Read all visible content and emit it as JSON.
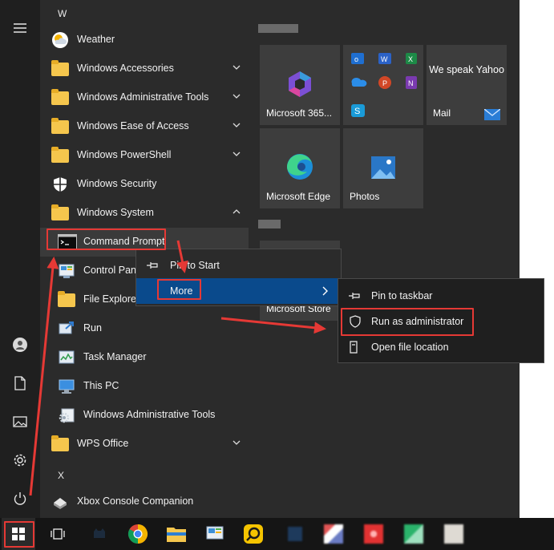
{
  "applist": {
    "letter_w": "W",
    "letter_x": "X",
    "items": [
      {
        "label": "Weather"
      },
      {
        "label": "Windows Accessories"
      },
      {
        "label": "Windows Administrative Tools"
      },
      {
        "label": "Windows Ease of Access"
      },
      {
        "label": "Windows PowerShell"
      },
      {
        "label": "Windows Security"
      },
      {
        "label": "Windows System"
      },
      {
        "label": "Command Prompt"
      },
      {
        "label": "Control Panel"
      },
      {
        "label": "File Explorer"
      },
      {
        "label": "Run"
      },
      {
        "label": "Task Manager"
      },
      {
        "label": "This PC"
      },
      {
        "label": "Windows Administrative Tools"
      },
      {
        "label": "WPS Office"
      },
      {
        "label": "Xbox Console Companion"
      }
    ]
  },
  "tiles": {
    "m365": "Microsoft 365...",
    "mail": "Mail",
    "mail_promo": "We speak Yahoo",
    "edge": "Microsoft Edge",
    "photos": "Photos",
    "store": "Microsoft Store"
  },
  "context1": {
    "pin_start": "Pin to Start",
    "more": "More"
  },
  "context2": {
    "pin_taskbar": "Pin to taskbar",
    "run_admin": "Run as administrator",
    "open_location": "Open file location"
  },
  "colors": {
    "highlight": "#e53935",
    "accent": "#0a4a8c",
    "start_bg": "#2b2b2b"
  }
}
